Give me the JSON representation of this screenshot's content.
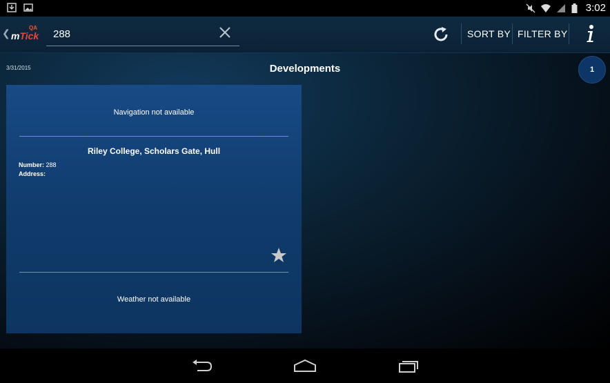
{
  "status_bar": {
    "time": "3:02"
  },
  "app": {
    "logo_badge": "QA",
    "logo_m": "m",
    "logo_tick": "Tick"
  },
  "search": {
    "value": "288",
    "placeholder": ""
  },
  "toolbar": {
    "sort_label": "SORT BY",
    "filter_label": "FILTER BY"
  },
  "page": {
    "date": "3/31/2015",
    "title": "Developments",
    "count": "1"
  },
  "card": {
    "navigation_message": "Navigation not available",
    "site_name": "Riley College, Scholars Gate, Hull",
    "number_label": "Number:",
    "number_value": "288",
    "address_label": "Address:",
    "address_value": "",
    "weather_message": "Weather not available"
  },
  "colors": {
    "accent": "#0d3566",
    "card": "#184a85",
    "logo_red": "#e8483b"
  },
  "icons": [
    "download-icon",
    "image-icon",
    "mute-icon",
    "wifi-icon",
    "signal-icon",
    "battery-icon",
    "back-chevron-icon",
    "clear-icon",
    "refresh-icon",
    "info-icon",
    "star-icon",
    "nav-back-icon",
    "nav-home-icon",
    "nav-recents-icon"
  ]
}
